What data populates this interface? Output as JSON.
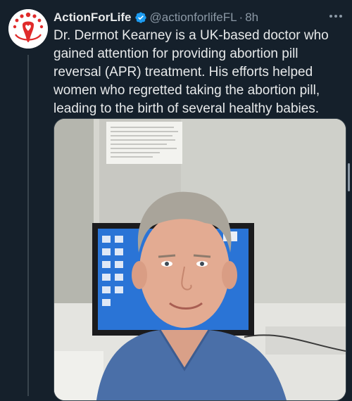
{
  "tweet": {
    "display_name": "ActionForLife",
    "handle": "@actionforlifeFL",
    "separator": "·",
    "timestamp": "8h",
    "text": "Dr. Dermot Kearney is a UK-based doctor who\ngained attention for providing abortion pill\nreversal (APR) treatment. His efforts helped\nwomen who regretted taking the abortion pill,\nleading to the birth of several healthy babies.",
    "verified": true,
    "avatar_icon": "actionforlife-logo-icon",
    "more_icon": "more-options-icon"
  },
  "media": {
    "description_icon": "doctor-photo-image",
    "wall_notice_icon": "wall-notice-paper"
  },
  "colors": {
    "background": "#15202b",
    "text": "#e7e9ea",
    "secondary_text": "#8b98a5",
    "verified_blue": "#1d9bf0",
    "logo_red": "#e02a2a",
    "scrubs_blue": "#4a6fa8"
  }
}
